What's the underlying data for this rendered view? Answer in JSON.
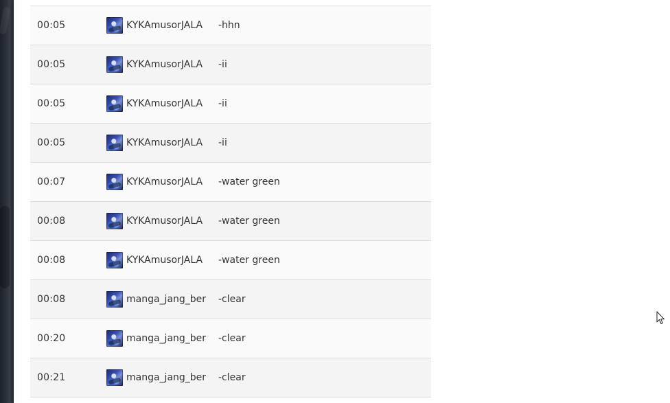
{
  "chat_log": {
    "rows": [
      {
        "time": "00:05",
        "player": "KYKAmusorJALA",
        "message": "-hhn"
      },
      {
        "time": "00:05",
        "player": "KYKAmusorJALA",
        "message": "-ii"
      },
      {
        "time": "00:05",
        "player": "KYKAmusorJALA",
        "message": "-ii"
      },
      {
        "time": "00:05",
        "player": "KYKAmusorJALA",
        "message": "-ii"
      },
      {
        "time": "00:07",
        "player": "KYKAmusorJALA",
        "message": "-water green"
      },
      {
        "time": "00:08",
        "player": "KYKAmusorJALA",
        "message": "-water green"
      },
      {
        "time": "00:08",
        "player": "KYKAmusorJALA",
        "message": "-water green"
      },
      {
        "time": "00:08",
        "player": "manga_jang_ber",
        "message": "-clear"
      },
      {
        "time": "00:20",
        "player": "manga_jang_ber",
        "message": "-clear"
      },
      {
        "time": "00:21",
        "player": "manga_jang_ber",
        "message": "-clear"
      }
    ]
  },
  "colors": {
    "row_odd": "#fafafa",
    "row_even": "#f4f4f4",
    "text": "#333333",
    "divider": "#dcdcdc"
  },
  "icons": {
    "avatar": "hero-portrait-icon",
    "cursor": "mouse-pointer-icon"
  }
}
